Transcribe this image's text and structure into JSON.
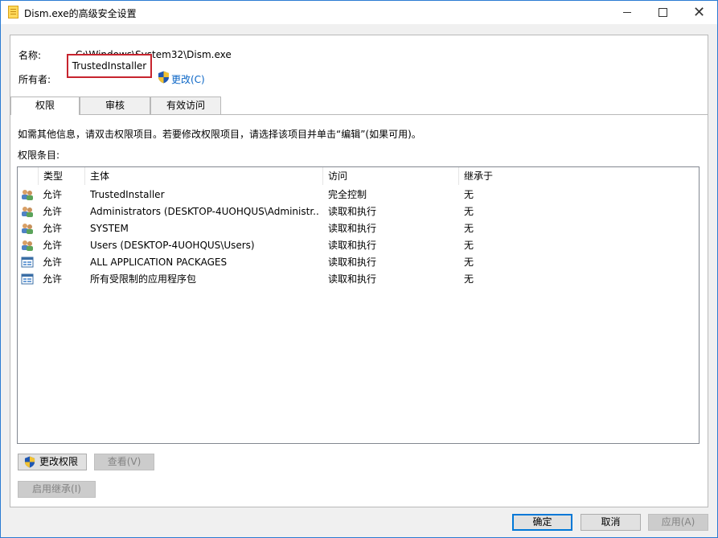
{
  "window": {
    "title": "Dism.exe的高级安全设置",
    "controls": {
      "minimize": "minimize",
      "maximize": "maximize",
      "close": "✕"
    }
  },
  "header": {
    "name_label": "名称:",
    "name_value": "C:\\Windows\\System32\\Dism.exe",
    "owner_label": "所有者:",
    "owner_value": "TrustedInstaller",
    "change_link": "更改(C)"
  },
  "tabs": [
    {
      "label": "权限",
      "active": true
    },
    {
      "label": "审核",
      "active": false
    },
    {
      "label": "有效访问",
      "active": false
    }
  ],
  "permissions": {
    "info_text": "如需其他信息，请双击权限项目。若要修改权限项目，请选择该项目并单击“编辑”(如果可用)。",
    "entries_label": "权限条目:",
    "columns": [
      "类型",
      "主体",
      "访问",
      "继承于"
    ],
    "rows": [
      {
        "icon": "users-icon",
        "type": "允许",
        "principal": "TrustedInstaller",
        "access": "完全控制",
        "inherited": "无"
      },
      {
        "icon": "users-icon",
        "type": "允许",
        "principal": "Administrators (DESKTOP-4UOHQUS\\Administr...",
        "access": "读取和执行",
        "inherited": "无"
      },
      {
        "icon": "users-icon",
        "type": "允许",
        "principal": "SYSTEM",
        "access": "读取和执行",
        "inherited": "无"
      },
      {
        "icon": "users-icon",
        "type": "允许",
        "principal": "Users (DESKTOP-4UOHQUS\\Users)",
        "access": "读取和执行",
        "inherited": "无"
      },
      {
        "icon": "app-package-icon",
        "type": "允许",
        "principal": "ALL APPLICATION PACKAGES",
        "access": "读取和执行",
        "inherited": "无"
      },
      {
        "icon": "app-package-icon",
        "type": "允许",
        "principal": "所有受限制的应用程序包",
        "access": "读取和执行",
        "inherited": "无"
      }
    ]
  },
  "buttons": {
    "change_permissions": "更改权限",
    "view": "查看(V)",
    "enable_inheritance": "启用继承(I)",
    "ok": "确定",
    "cancel": "取消",
    "apply": "应用(A)"
  }
}
